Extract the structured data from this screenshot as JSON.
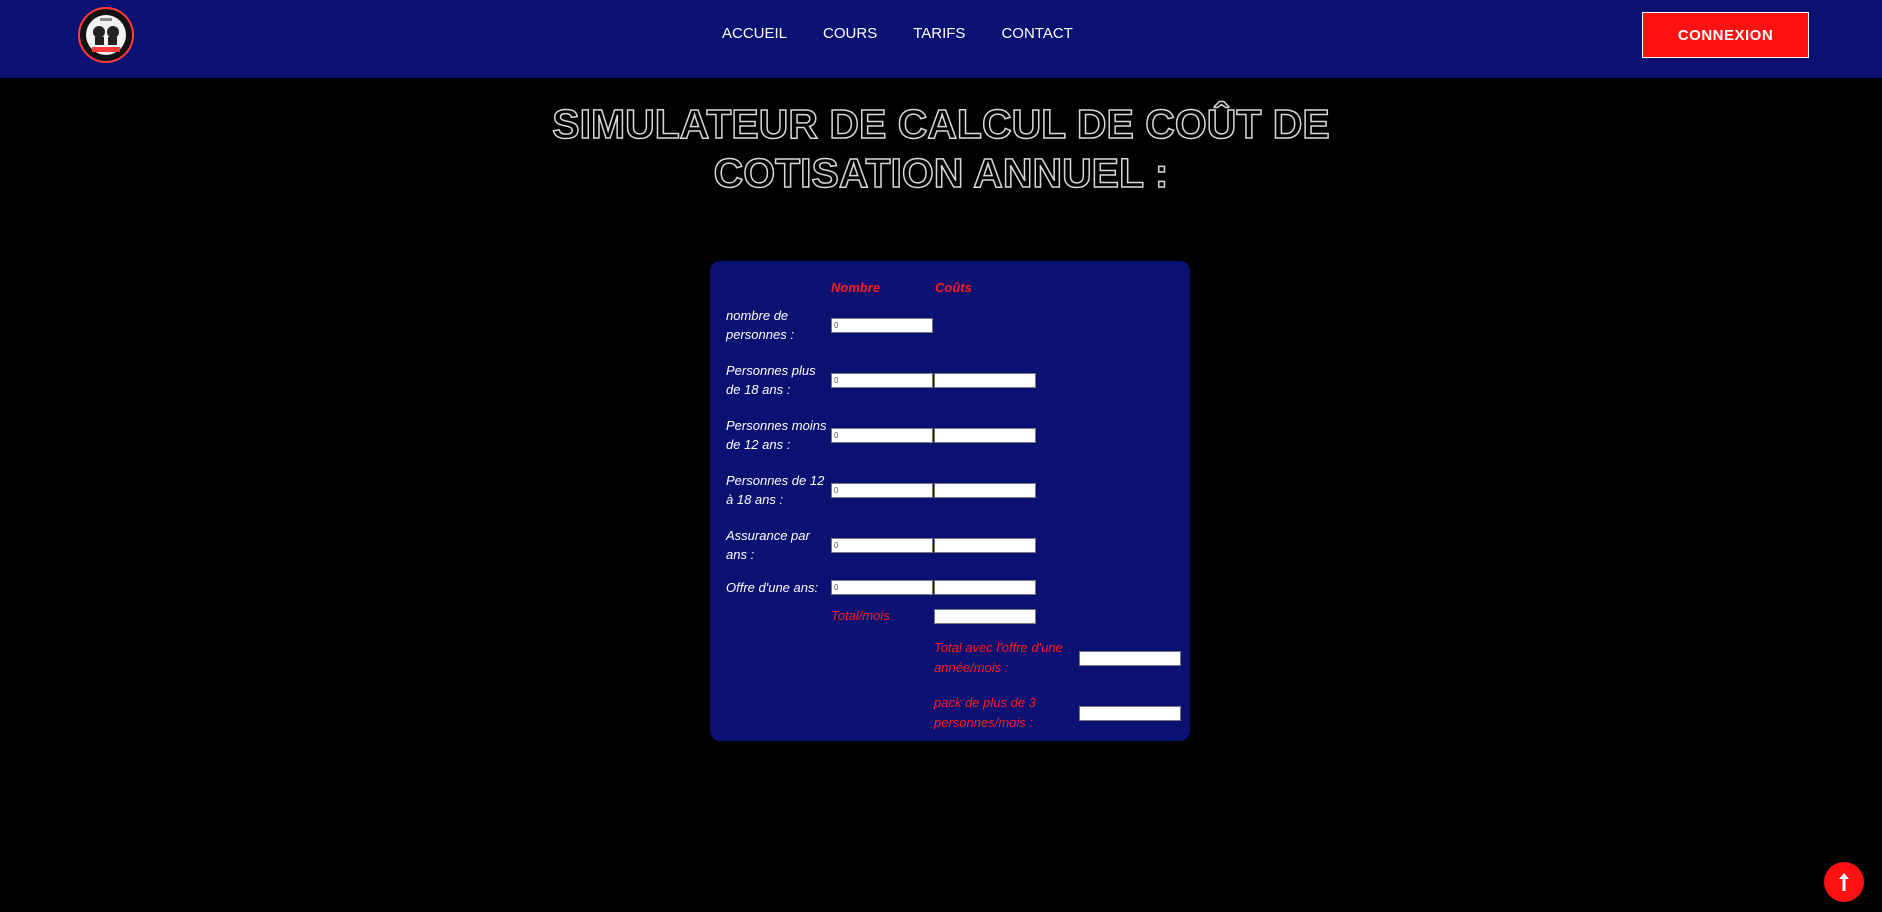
{
  "navbar": {
    "logo_icon": "boxing-club-logo",
    "links": [
      {
        "label": "ACCUEIL"
      },
      {
        "label": "COURS"
      },
      {
        "label": "TARIFS"
      },
      {
        "label": "CONTACT"
      }
    ],
    "connexion_label": "CONNEXION"
  },
  "page": {
    "title": "SIMULATEUR DE CALCUL DE COÛT DE COTISATION ANNUEL :"
  },
  "simulator": {
    "headers": {
      "nombre": "Nombre",
      "couts": "Coûts"
    },
    "rows": [
      {
        "label": "nombre de personnes :",
        "nombre_value": "0",
        "has_cost": false
      },
      {
        "label": "Personnes plus de 18 ans :",
        "nombre_value": "0",
        "has_cost": true,
        "cost_value": ""
      },
      {
        "label": "Personnes moins de 12 ans :",
        "nombre_value": "0",
        "has_cost": true,
        "cost_value": ""
      },
      {
        "label": "Personnes de 12 à 18 ans :",
        "nombre_value": "0",
        "has_cost": true,
        "cost_value": ""
      },
      {
        "label": "Assurance par ans :",
        "nombre_value": "0",
        "has_cost": true,
        "cost_value": ""
      },
      {
        "label": "Offre d'une ans:",
        "nombre_value": "0",
        "has_cost": true,
        "cost_value": ""
      }
    ],
    "total_mois_label": "Total/mois",
    "total_mois_value": "",
    "total_offre_label": "Total avec l'offre d'une année/mois :",
    "total_offre_value": "",
    "pack_label": "pack de plus de 3 personnes/mois :",
    "pack_value": ""
  },
  "scroll_top": {
    "icon": "arrow-up-icon"
  },
  "colors": {
    "navbar_bg": "#0a1172",
    "accent_red": "#ff1111",
    "page_bg": "#000000",
    "panel_bg": "#0a1172"
  }
}
